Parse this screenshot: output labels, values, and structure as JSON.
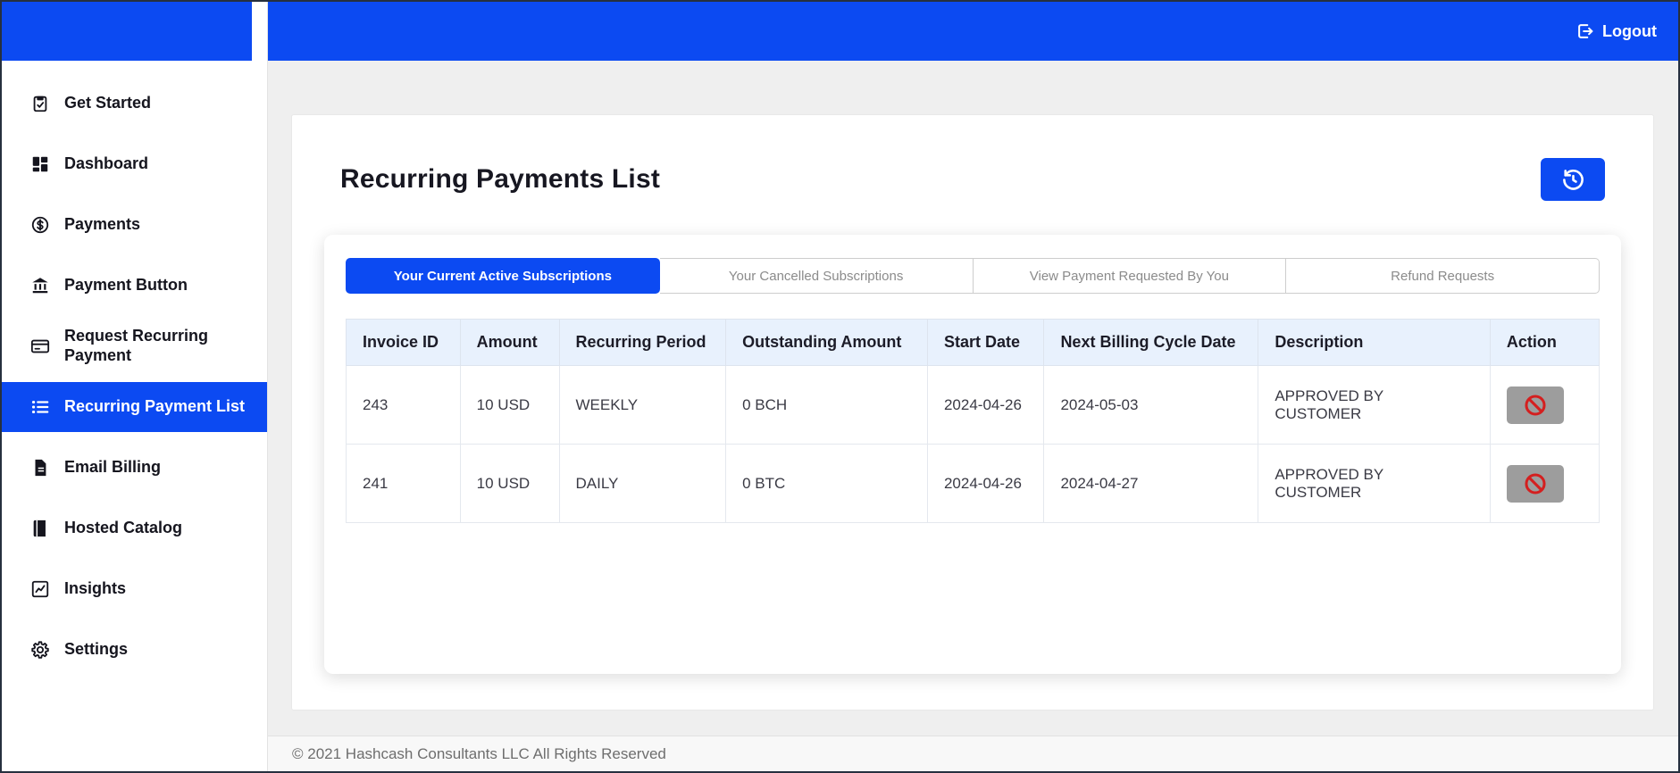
{
  "colors": {
    "primary": "#0c4af2",
    "content_bg": "#efefef",
    "table_header_bg": "#e8f1fd",
    "action_button_bg": "#9d9d9d",
    "cancel_red": "#d41f1f",
    "sidebar_text": "#15151e"
  },
  "topbar": {
    "logout_label": "Logout",
    "logout_icon": "box-arrow-right-icon"
  },
  "sidebar": {
    "items": [
      {
        "label": "Get Started",
        "icon": "clipboard-check-icon",
        "active": false
      },
      {
        "label": "Dashboard",
        "icon": "dashboard-grid-icon",
        "active": false
      },
      {
        "label": "Payments",
        "icon": "dollar-circle-icon",
        "active": false
      },
      {
        "label": "Payment Button",
        "icon": "bank-icon",
        "active": false
      },
      {
        "label": "Request Recurring Payment",
        "icon": "credit-card-icon",
        "active": false
      },
      {
        "label": "Recurring Payment List",
        "icon": "list-icon",
        "active": true
      },
      {
        "label": "Email Billing",
        "icon": "document-icon",
        "active": false
      },
      {
        "label": "Hosted Catalog",
        "icon": "book-icon",
        "active": false
      },
      {
        "label": "Insights",
        "icon": "chart-icon",
        "active": false
      },
      {
        "label": "Settings",
        "icon": "gear-icon",
        "active": false
      }
    ]
  },
  "main": {
    "title": "Recurring Payments List",
    "history_button_icon": "clock-history-icon",
    "tabs": [
      {
        "label": "Your Current Active Subscriptions",
        "active": true
      },
      {
        "label": "Your Cancelled Subscriptions",
        "active": false
      },
      {
        "label": "View Payment Requested By You",
        "active": false
      },
      {
        "label": "Refund Requests",
        "active": false
      }
    ],
    "table": {
      "columns": [
        "Invoice ID",
        "Amount",
        "Recurring Period",
        "Outstanding Amount",
        "Start Date",
        "Next Billing Cycle Date",
        "Description",
        "Action"
      ],
      "rows": [
        {
          "invoice_id": "243",
          "amount": "10 USD",
          "recurring_period": "WEEKLY",
          "outstanding_amount": "0 BCH",
          "start_date": "2024-04-26",
          "next_billing_cycle_date": "2024-05-03",
          "description": "APPROVED BY CUSTOMER",
          "action_icon": "prohibition-icon"
        },
        {
          "invoice_id": "241",
          "amount": "10 USD",
          "recurring_period": "DAILY",
          "outstanding_amount": "0 BTC",
          "start_date": "2024-04-26",
          "next_billing_cycle_date": "2024-04-27",
          "description": "APPROVED BY CUSTOMER",
          "action_icon": "prohibition-icon"
        }
      ]
    }
  },
  "footer": {
    "copyright": "© 2021 Hashcash Consultants LLC All Rights Reserved"
  }
}
